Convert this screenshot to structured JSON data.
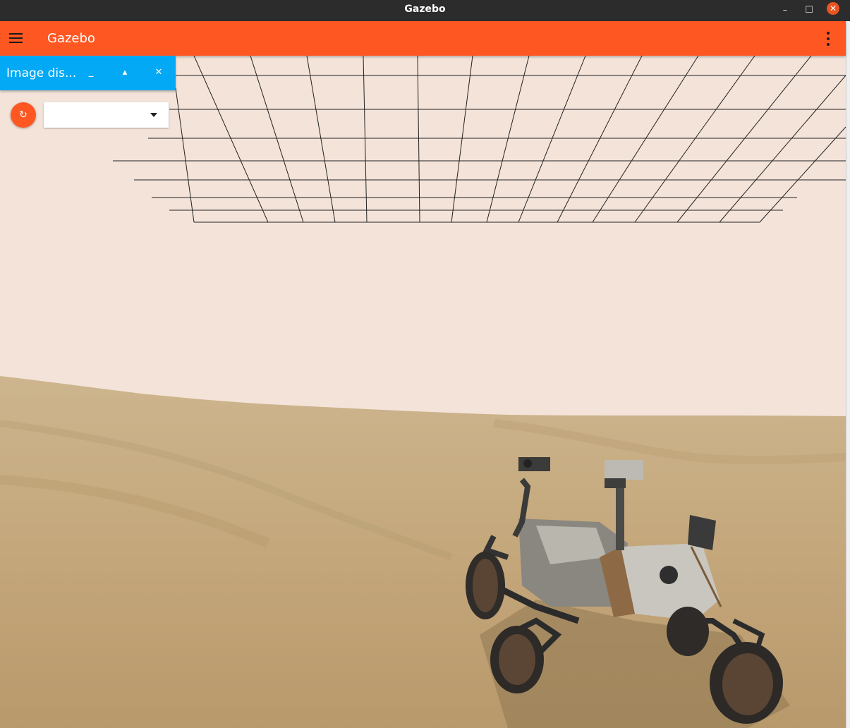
{
  "window": {
    "title": "Gazebo",
    "minimize_glyph": "–",
    "maximize_glyph": "☐",
    "close_glyph": "✕"
  },
  "appbar": {
    "title": "Gazebo",
    "menu_icon": "hamburger-icon",
    "more_icon": "kebab-icon",
    "color": "#ff5722"
  },
  "image_display": {
    "title": "Image dis...",
    "minimize_glyph": "_",
    "undock_glyph": "▴",
    "close_glyph": "✕",
    "refresh_glyph": "↻",
    "topic_value": "",
    "header_color": "#03a9f4"
  },
  "scene": {
    "sky_color": "#f3e3d9",
    "ground_color": "#c9b084"
  }
}
